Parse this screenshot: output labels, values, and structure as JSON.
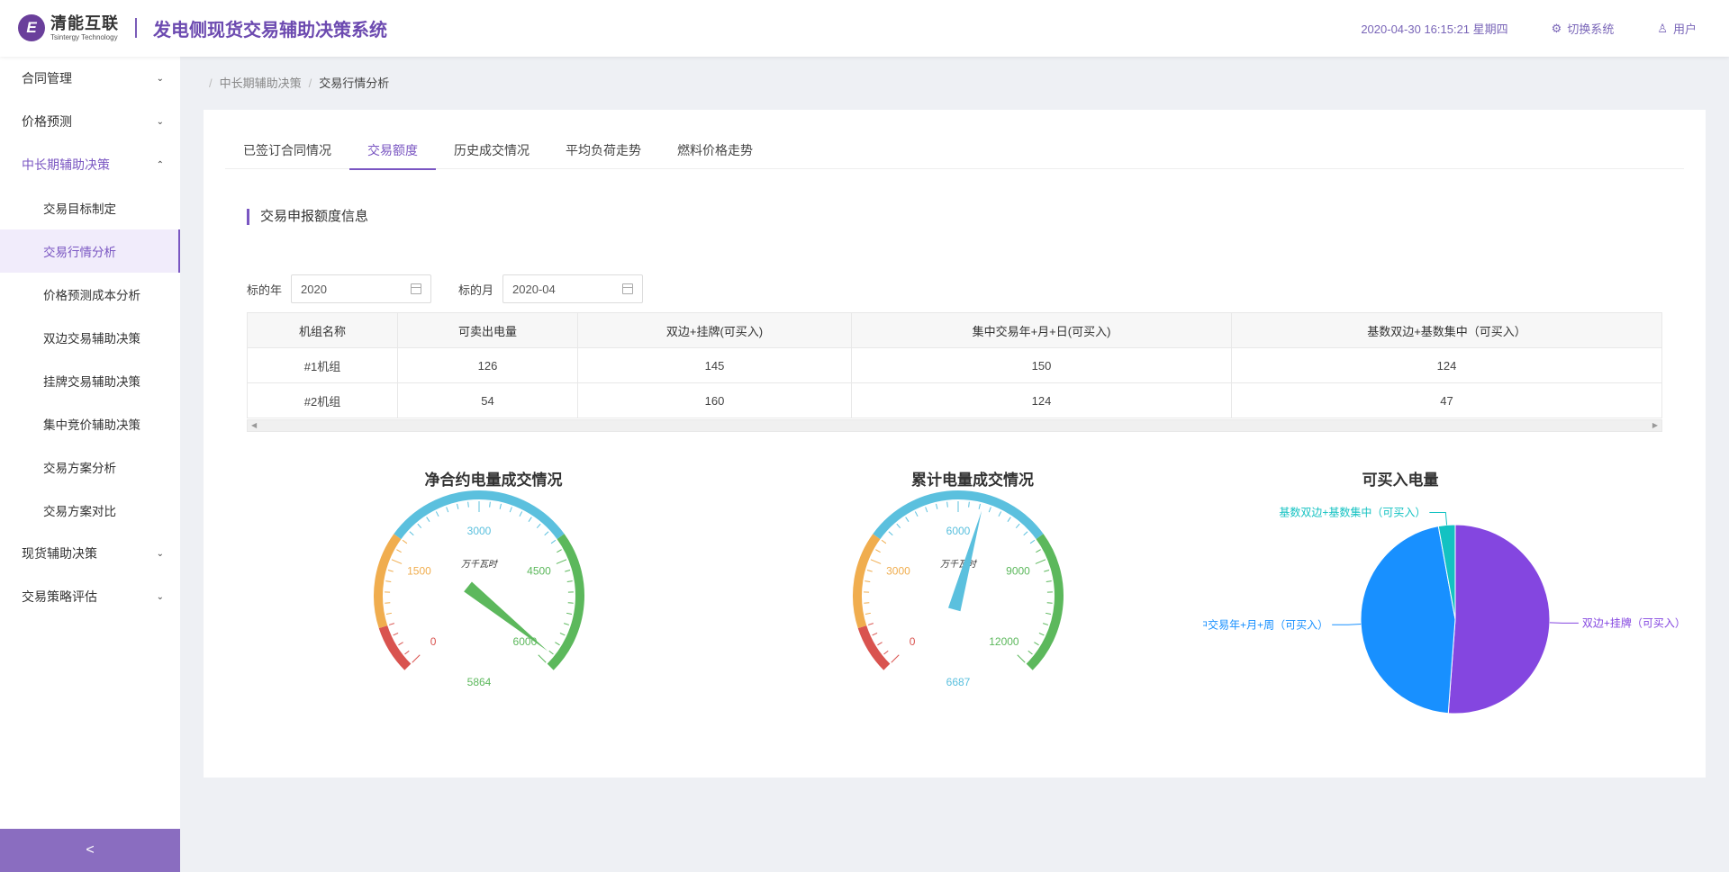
{
  "header": {
    "logo_cn": "清能互联",
    "logo_en": "Tsintergy Technology",
    "system_title": "发电侧现货交易辅助决策系统",
    "datetime": "2020-04-30 16:15:21 星期四",
    "switch_system": "切换系统",
    "user": "用户"
  },
  "sidebar": {
    "items": [
      {
        "label": "合同管理"
      },
      {
        "label": "价格预测"
      },
      {
        "label": "中长期辅助决策"
      },
      {
        "label": "交易目标制定"
      },
      {
        "label": "交易行情分析"
      },
      {
        "label": "价格预测成本分析"
      },
      {
        "label": "双边交易辅助决策"
      },
      {
        "label": "挂牌交易辅助决策"
      },
      {
        "label": "集中竞价辅助决策"
      },
      {
        "label": "交易方案分析"
      },
      {
        "label": "交易方案对比"
      },
      {
        "label": "现货辅助决策"
      },
      {
        "label": "交易策略评估"
      }
    ],
    "collapse": "<"
  },
  "breadcrumb": {
    "sep": "/",
    "level1": "中长期辅助决策",
    "level2": "交易行情分析"
  },
  "tabs": [
    "已签订合同情况",
    "交易额度",
    "历史成交情况",
    "平均负荷走势",
    "燃料价格走势"
  ],
  "section_title": "交易申报额度信息",
  "filters": {
    "year_label": "标的年",
    "year_value": "2020",
    "month_label": "标的月",
    "month_value": "2020-04"
  },
  "table": {
    "headers": [
      "机组名称",
      "可卖出电量",
      "双边+挂牌(可买入)",
      "集中交易年+月+日(可买入)",
      "基数双边+基数集中（可买入）"
    ],
    "rows": [
      [
        "#1机组",
        "126",
        "145",
        "150",
        "124"
      ],
      [
        "#2机组",
        "54",
        "160",
        "124",
        "47"
      ]
    ]
  },
  "chart_data": [
    {
      "type": "gauge",
      "title": "净合约电量成交情况",
      "unit": "万千瓦时",
      "min": 0,
      "max": 6000,
      "ticks": [
        "0",
        "1500",
        "3000",
        "4500",
        "6000"
      ],
      "value": 5864,
      "value_label": "5864",
      "bands": [
        {
          "to": 0.1,
          "color": "#d9534f"
        },
        {
          "to": 0.3,
          "color": "#f0ad4e"
        },
        {
          "to": 0.7,
          "color": "#5bc0de"
        },
        {
          "to": 1.0,
          "color": "#5cb85c"
        }
      ]
    },
    {
      "type": "gauge",
      "title": "累计电量成交情况",
      "unit": "万千瓦时",
      "min": 0,
      "max": 12000,
      "ticks": [
        "0",
        "3000",
        "6000",
        "9000",
        "12000"
      ],
      "value": 6687,
      "value_label": "6687",
      "bands": [
        {
          "to": 0.1,
          "color": "#d9534f"
        },
        {
          "to": 0.3,
          "color": "#f0ad4e"
        },
        {
          "to": 0.7,
          "color": "#5bc0de"
        },
        {
          "to": 1.0,
          "color": "#5cb85c"
        }
      ]
    },
    {
      "type": "pie",
      "title": "可买入电量",
      "series": [
        {
          "name": "双边+挂牌（可买入）",
          "value": 305,
          "color": "#8446e0"
        },
        {
          "name": "集中交易年+月+周（可买入）",
          "value": 274,
          "color": "#1890ff"
        },
        {
          "name": "基数双边+基数集中（可买入）",
          "value": 17,
          "color": "#13c2c2"
        }
      ]
    }
  ]
}
